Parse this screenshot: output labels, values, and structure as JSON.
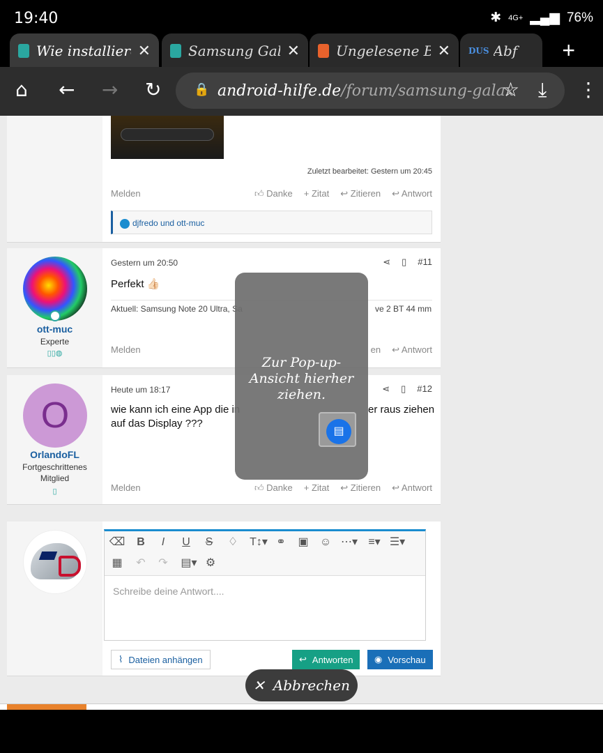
{
  "status": {
    "time": "19:40",
    "network": "4G+",
    "battery": "76%"
  },
  "tabs": [
    {
      "title": "Wie installiere",
      "favicon_color": "#2aa7a0",
      "active": true
    },
    {
      "title": "Samsung Gala",
      "favicon_color": "#2aa7a0",
      "active": false
    },
    {
      "title": "Ungelesene Bei",
      "favicon_color": "#e8622c",
      "active": false
    },
    {
      "title": "Abf",
      "favicon_label": "DUS",
      "active": false
    }
  ],
  "toolbar": {
    "url_host": "android-hilfe.de",
    "url_path": "/forum/samsung-galax"
  },
  "posts": [
    {
      "edited": "Zuletzt bearbeitet: Gestern um 20:45",
      "reactions": "djfredo und ott-muc",
      "actions": {
        "report": "Melden",
        "thanks": "Danke",
        "quote": "Zitat",
        "cite": "Zitieren",
        "reply": "Antwort"
      }
    },
    {
      "user": "ott-muc",
      "role": "Experte",
      "date": "Gestern um 20:50",
      "number": "#11",
      "message": "Perfekt 👍🏻",
      "signature": "Aktuell: Samsung Note 20 Ultra, Sa",
      "signature_end": "ve 2 BT 44 mm",
      "actions": {
        "report": "Melden",
        "cite": "en",
        "reply": "Antwort"
      }
    },
    {
      "user": "OrlandoFL",
      "initial": "O",
      "role": "Fortgeschrittenes Mitglied",
      "date": "Heute um 18:17",
      "number": "#12",
      "message_line1": "wie kann ich eine App die in",
      "message_line1_end": "er raus ziehen",
      "message_line2": "auf das Display ???",
      "actions": {
        "report": "Melden",
        "thanks": "Danke",
        "quote": "Zitat",
        "cite": "Zitieren",
        "reply": "Antwort"
      }
    }
  ],
  "editor": {
    "placeholder": "Schreibe deine Antwort....",
    "attach_label": "Dateien anhängen",
    "reply_label": "Antworten",
    "preview_label": "Vorschau"
  },
  "popup": {
    "text": "Zur Pop-up-Ansicht hierher ziehen."
  },
  "cancel_label": "Abbrechen",
  "colors": {
    "link": "#1a5fa0",
    "reply_button": "#16a085",
    "preview_button": "#1a6fb8",
    "badge": "#2aa7a0"
  }
}
